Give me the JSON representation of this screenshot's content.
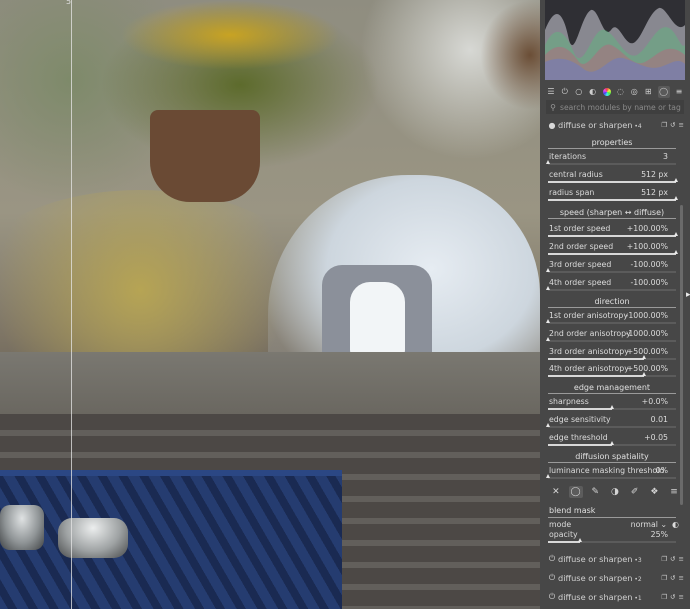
{
  "canvas": {
    "marker": "5"
  },
  "toolbar": {
    "icons": [
      "sliders-icon",
      "power-icon",
      "circle-icon",
      "half-circle-icon",
      "color-wheel-icon",
      "palette-icon",
      "swirl-icon",
      "grid-icon",
      "ring-icon",
      "menu-icon"
    ]
  },
  "search": {
    "placeholder": "search modules by name or tag"
  },
  "module": {
    "title": "diffuse or sharpen",
    "instance": "4",
    "sections": {
      "properties": "properties",
      "speed": "speed (sharpen ↔ diffuse)",
      "direction": "direction",
      "edge": "edge management",
      "spatiality": "diffusion spatiality"
    },
    "sliders": {
      "iterations": {
        "label": "iterations",
        "value": "3",
        "position": 0.0
      },
      "central_radius": {
        "label": "central radius",
        "value": "512 px",
        "position": 1.0
      },
      "radius_span": {
        "label": "radius span",
        "value": "512 px",
        "position": 1.0
      },
      "first_speed": {
        "label": "1st order speed",
        "value": "+100.00%",
        "position": 1.0
      },
      "second_speed": {
        "label": "2nd order speed",
        "value": "+100.00%",
        "position": 1.0
      },
      "third_speed": {
        "label": "3rd order speed",
        "value": "-100.00%",
        "position": 0.0
      },
      "fourth_speed": {
        "label": "4th order speed",
        "value": "-100.00%",
        "position": 0.0
      },
      "first_aniso": {
        "label": "1st order anisotropy",
        "value": "-1000.00%",
        "position": 0.0
      },
      "second_aniso": {
        "label": "2nd order anisotropy",
        "value": "-1000.00%",
        "position": 0.0
      },
      "third_aniso": {
        "label": "3rd order anisotropy",
        "value": "+500.00%",
        "position": 0.75
      },
      "fourth_aniso": {
        "label": "4th order anisotropy",
        "value": "+500.00%",
        "position": 0.75
      },
      "sharpness": {
        "label": "sharpness",
        "value": "+0.0%",
        "position": 0.5
      },
      "edge_sensitivity": {
        "label": "edge sensitivity",
        "value": "0.01",
        "position": 0.0
      },
      "edge_threshold": {
        "label": "edge threshold",
        "value": "+0.05",
        "position": 0.5
      },
      "luminance_masking": {
        "label": "luminance masking threshold",
        "value": "0%",
        "position": 0.0
      }
    }
  },
  "blend": {
    "icons": [
      "close-icon",
      "circle-mask-icon",
      "pen-mask-icon",
      "parametric-mask-icon",
      "raster-mask-icon",
      "combined-mask-icon",
      "menu-icon"
    ],
    "title": "blend mask",
    "mode_label": "mode",
    "mode_value": "normal",
    "opacity": {
      "label": "opacity",
      "value": "25%",
      "position": 0.25
    }
  },
  "instances": [
    {
      "title": "diffuse or sharpen",
      "instance": "3"
    },
    {
      "title": "diffuse or sharpen",
      "instance": "2"
    },
    {
      "title": "diffuse or sharpen",
      "instance": "1"
    }
  ]
}
